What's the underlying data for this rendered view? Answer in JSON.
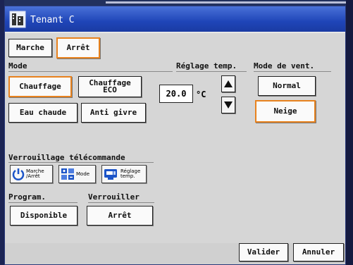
{
  "window": {
    "title": "Tenant C"
  },
  "onoff": {
    "on_label": "Marche",
    "off_label": "Arrêt",
    "selected": "off"
  },
  "mode": {
    "heading": "Mode",
    "chauffage": "Chauffage",
    "chauffage_eco_line1": "Chauffage",
    "chauffage_eco_line2": "ECO",
    "eau_chaude": "Eau chaude",
    "anti_givre": "Anti givre",
    "selected": "Chauffage"
  },
  "temp": {
    "heading": "Réglage temp.",
    "value": "20.0",
    "unit": "°C"
  },
  "fan": {
    "heading": "Mode de vent.",
    "normal": "Normal",
    "neige": "Neige",
    "selected": "Neige"
  },
  "remote_lock": {
    "heading": "Verrouillage télécommande",
    "onoff_line1": "Marche",
    "onoff_line2": "/Arrêt",
    "mode": "Mode",
    "temp_line1": "Réglage",
    "temp_line2": "temp."
  },
  "program": {
    "heading": "Program.",
    "value": "Disponible"
  },
  "lock": {
    "heading": "Verrouiller",
    "value": "Arrêt"
  },
  "footer": {
    "ok": "Valider",
    "cancel": "Annuler"
  },
  "colors": {
    "selected_border": "#e8821e",
    "title_bar": "#1f45b8",
    "panel": "#d6d6d6"
  }
}
